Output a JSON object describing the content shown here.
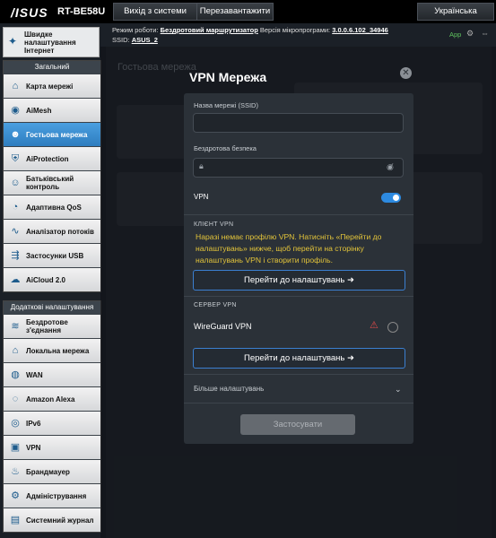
{
  "topbar": {
    "logo": "/ISUS",
    "model": "RT-BE58U",
    "logout_label": "Вихід з системи",
    "reboot_label": "Перезавантажити",
    "language": "Українська"
  },
  "status": {
    "mode_label": "Режим роботи:",
    "mode_value": "Бездротовий маршрутизатор",
    "firmware_label": "Версія мікропрограми:",
    "firmware_value": "3.0.0.6.102_34946",
    "ssid_label": "SSID:",
    "ssid_value": "ASUS_2",
    "app_label": "App"
  },
  "sidebar": {
    "quick_label": "Швидке налаштування Інтернет",
    "general_title": "Загальний",
    "general_items": [
      {
        "label": "Карта мережі",
        "icon": "network-map-icon"
      },
      {
        "label": "AiMesh",
        "icon": "aimesh-icon"
      },
      {
        "label": "Гостьова мережа",
        "icon": "guest-network-icon"
      },
      {
        "label": "AiProtection",
        "icon": "aiprotection-icon"
      },
      {
        "label": "Батьківський контроль",
        "icon": "parental-control-icon"
      },
      {
        "label": "Адаптивна QoS",
        "icon": "qos-icon"
      },
      {
        "label": "Аналізатор потоків",
        "icon": "traffic-analyzer-icon"
      },
      {
        "label": "Застосунки USB",
        "icon": "usb-icon"
      },
      {
        "label": "AiCloud 2.0",
        "icon": "aicloud-icon"
      }
    ],
    "advanced_title": "Додаткові налаштування",
    "advanced_items": [
      {
        "label": "Бездротове з'єднання",
        "icon": "wireless-icon"
      },
      {
        "label": "Локальна мережа",
        "icon": "lan-icon"
      },
      {
        "label": "WAN",
        "icon": "wan-icon"
      },
      {
        "label": "Amazon Alexa",
        "icon": "alexa-icon"
      },
      {
        "label": "IPv6",
        "icon": "ipv6-icon"
      },
      {
        "label": "VPN",
        "icon": "vpn-icon"
      },
      {
        "label": "Брандмауер",
        "icon": "firewall-icon"
      },
      {
        "label": "Адміністрування",
        "icon": "administration-icon"
      },
      {
        "label": "Системний журнал",
        "icon": "system-log-icon"
      }
    ]
  },
  "background": {
    "title": "Гостьова мережа"
  },
  "modal": {
    "title": "VPN Мережа",
    "ssid_label": "Назва мережі (SSID)",
    "ssid_value": "",
    "security_label": "Бездротова безпека",
    "security_value": "",
    "vpn_label": "VPN",
    "vpn_enabled": true,
    "client_header": "КЛІЄНТ VPN",
    "client_warning": "Наразі немає профілю VPN. Натисніть «Перейти до налаштувань» нижче, щоб перейти на сторінку налаштувань VPN і створити профіль.",
    "goto_label": "Перейти до налаштувань",
    "server_header": "СЕРВЕР VPN",
    "wireguard_label": "WireGuard VPN",
    "goto_label_2": "Перейти до налаштувань",
    "more_settings": "Більше налаштувань",
    "apply_label": "Застосувати"
  }
}
